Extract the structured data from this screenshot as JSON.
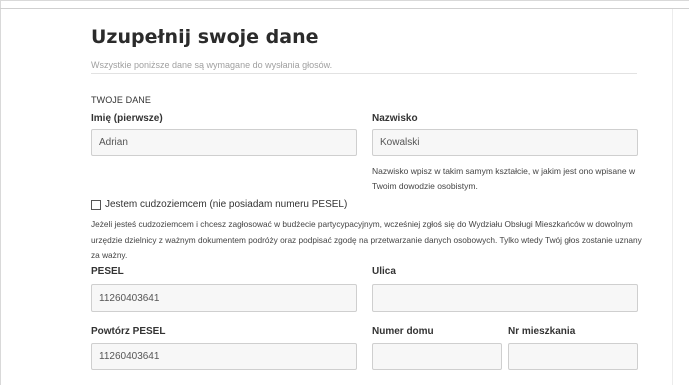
{
  "form": {
    "title": "Uzupełnij swoje dane",
    "subtitle": "Wszystkie poniższe dane są wymagane do wysłania głosów.",
    "section_title": "TWOJE DANE",
    "first_name": {
      "label": "Imię (pierwsze)",
      "value": "Adrian"
    },
    "last_name": {
      "label": "Nazwisko",
      "value": "Kowalski"
    },
    "last_name_hint": "Nazwisko wpisz w takim samym kształcie, w jakim jest ono wpisane w Twoim dowodzie osobistym.",
    "foreigner_checkbox": {
      "label": "Jestem cudzoziemcem (nie posiadam numeru PESEL)",
      "checked": false
    },
    "foreigner_notice": "Jeżeli jesteś cudzoziemcem i chcesz zagłosować w budżecie partycypacyjnym, wcześniej zgłoś się do Wydziału Obsługi Mieszkańców w dowolnym urzędzie dzielnicy z ważnym dokumentem podróży oraz podpisać zgodę na przetwarzanie danych osobowych. Tylko wtedy Twój głos zostanie uznany za ważny.",
    "pesel": {
      "label": "PESEL",
      "value": "11260403641"
    },
    "street": {
      "label": "Ulica",
      "value": ""
    },
    "pesel_repeat": {
      "label": "Powtórz PESEL",
      "value": "11260403641"
    },
    "house_number": {
      "label": "Numer domu",
      "value": ""
    },
    "apartment_number": {
      "label": "Nr mieszkania",
      "value": ""
    }
  }
}
